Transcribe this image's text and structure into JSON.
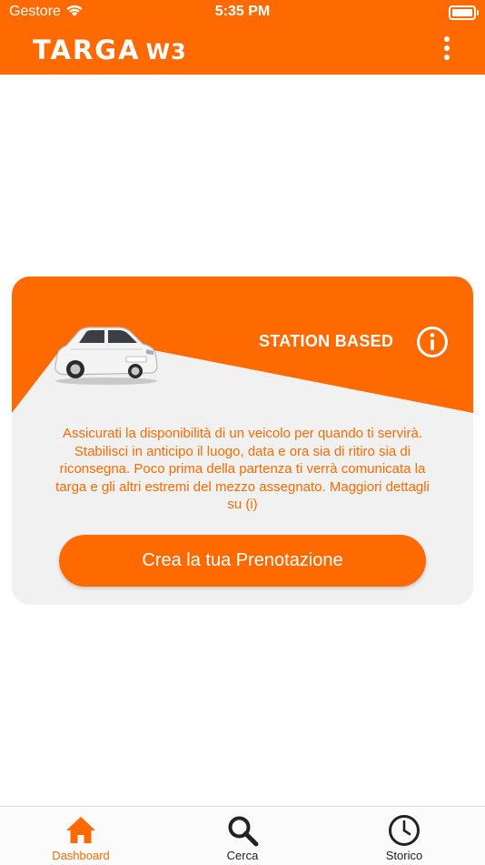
{
  "status_bar": {
    "carrier": "Gestore",
    "time": "5:35 PM"
  },
  "app_bar": {
    "logo_main": "TARGA",
    "logo_suffix": "W3"
  },
  "card": {
    "title": "STATION BASED",
    "description": "Assicurati la disponibilità di un veicolo per quando ti servirà. Stabilisci in anticipo il luogo, data e ora sia di ritiro sia di riconsegna. Poco prima della partenza ti verrà comunicata la targa e gli altri estremi del mezzo assegnato. Maggiori dettagli su (i)",
    "button_label": "Crea la tua Prenotazione"
  },
  "tabs": [
    {
      "label": "Dashboard",
      "icon": "home-icon",
      "active": true
    },
    {
      "label": "Cerca",
      "icon": "search-icon",
      "active": false
    },
    {
      "label": "Storico",
      "icon": "clock-icon",
      "active": false
    }
  ],
  "colors": {
    "accent": "#ff6a00",
    "card_background": "#f1f1f1",
    "tab_inactive": "#222222"
  }
}
